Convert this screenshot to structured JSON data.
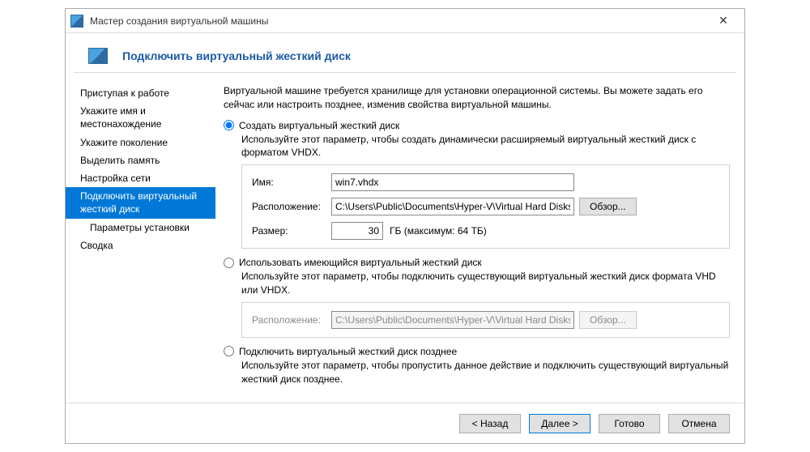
{
  "titlebar": {
    "title": "Мастер создания виртуальной машины"
  },
  "header": {
    "title": "Подключить виртуальный жесткий диск"
  },
  "sidebar": {
    "items": [
      {
        "label": "Приступая к работе"
      },
      {
        "label": "Укажите имя и местонахождение"
      },
      {
        "label": "Укажите поколение"
      },
      {
        "label": "Выделить память"
      },
      {
        "label": "Настройка сети"
      },
      {
        "label": "Подключить виртуальный жесткий диск"
      },
      {
        "label": "Параметры установки"
      },
      {
        "label": "Сводка"
      }
    ]
  },
  "content": {
    "intro": "Виртуальной машине требуется хранилище для установки операционной системы. Вы можете задать его сейчас или настроить позднее, изменив свойства виртуальной машины.",
    "opt1": {
      "label": "Создать виртуальный жесткий диск",
      "desc": "Используйте этот параметр, чтобы создать динамически расширяемый виртуальный жесткий диск с форматом VHDX.",
      "name_label": "Имя:",
      "name_value": "win7.vhdx",
      "loc_label": "Расположение:",
      "loc_value": "C:\\Users\\Public\\Documents\\Hyper-V\\Virtual Hard Disks\\",
      "browse": "Обзор...",
      "size_label": "Размер:",
      "size_value": "30",
      "size_unit": "ГБ (максимум: 64 ТБ)"
    },
    "opt2": {
      "label": "Использовать имеющийся виртуальный жесткий диск",
      "desc": "Используйте этот параметр, чтобы подключить существующий виртуальный жесткий диск формата VHD или VHDX.",
      "loc_label": "Расположение:",
      "loc_value": "C:\\Users\\Public\\Documents\\Hyper-V\\Virtual Hard Disks\\",
      "browse": "Обзор..."
    },
    "opt3": {
      "label": "Подключить виртуальный жесткий диск позднее",
      "desc": "Используйте этот параметр, чтобы пропустить данное действие и подключить существующий виртуальный жесткий диск позднее."
    }
  },
  "footer": {
    "back": "< Назад",
    "next": "Далее >",
    "finish": "Готово",
    "cancel": "Отмена"
  }
}
